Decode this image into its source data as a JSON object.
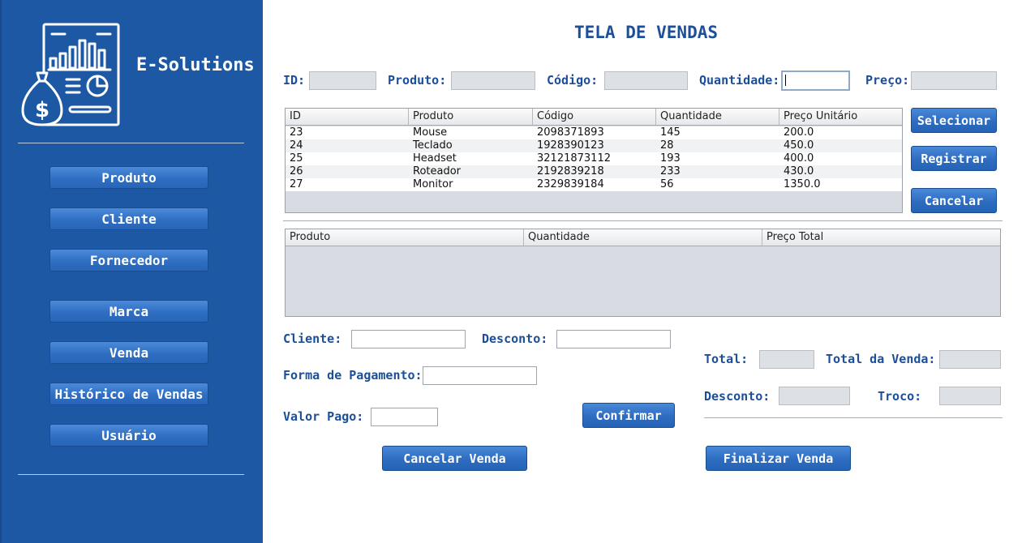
{
  "sidebar": {
    "brand": "E-Solutions",
    "logo_icon": "finance-report-icon",
    "items": [
      {
        "label": "Produto"
      },
      {
        "label": "Cliente"
      },
      {
        "label": "Fornecedor"
      },
      {
        "label": "Marca"
      },
      {
        "label": "Venda"
      },
      {
        "label": "Histórico de Vendas"
      },
      {
        "label": "Usuário"
      }
    ]
  },
  "main": {
    "title": "TELA DE VENDAS",
    "search": {
      "id_label": "ID:",
      "produto_label": "Produto:",
      "codigo_label": "Código:",
      "quantidade_label": "Quantidade:",
      "preco_label": "Preço:",
      "id_value": "",
      "produto_value": "",
      "codigo_value": "",
      "quantidade_value": "",
      "preco_value": ""
    },
    "products_table": {
      "columns": [
        "ID",
        "Produto",
        "Código",
        "Quantidade",
        "Preço Unitário"
      ],
      "rows": [
        [
          "23",
          "Mouse",
          "2098371893",
          "145",
          "200.0"
        ],
        [
          "24",
          "Teclado",
          "1928390123",
          "28",
          "450.0"
        ],
        [
          "25",
          "Headset",
          "32121873112",
          "193",
          "400.0"
        ],
        [
          "26",
          "Roteador",
          "2192839218",
          "233",
          "430.0"
        ],
        [
          "27",
          "Monitor",
          "2329839184",
          "56",
          "1350.0"
        ]
      ]
    },
    "side_buttons": {
      "selecionar": "Selecionar",
      "registrar": "Registrar",
      "cancelar": "Cancelar"
    },
    "cart_table": {
      "columns": [
        "Produto",
        "Quantidade",
        "Preço Total"
      ],
      "rows": []
    },
    "form": {
      "cliente_label": "Cliente:",
      "desconto_label": "Desconto:",
      "forma_pagamento_label": "Forma de Pagamento:",
      "valor_pago_label": "Valor Pago:",
      "confirmar": "Confirmar",
      "cliente_value": "",
      "desconto_value": "",
      "forma_pagamento_value": "",
      "valor_pago_value": ""
    },
    "summary": {
      "total_label": "Total:",
      "total_venda_label": "Total da Venda:",
      "desconto_label": "Desconto:",
      "troco_label": "Troco:",
      "total_value": "",
      "total_venda_value": "",
      "desconto_value": "",
      "troco_value": ""
    },
    "footer": {
      "cancelar_venda": "Cancelar Venda",
      "finalizar_venda": "Finalizar Venda"
    }
  },
  "colors": {
    "sidebar_bg": "#1c58a4",
    "label_text": "#1c4f97",
    "button_blue": "#2d6cc0"
  }
}
